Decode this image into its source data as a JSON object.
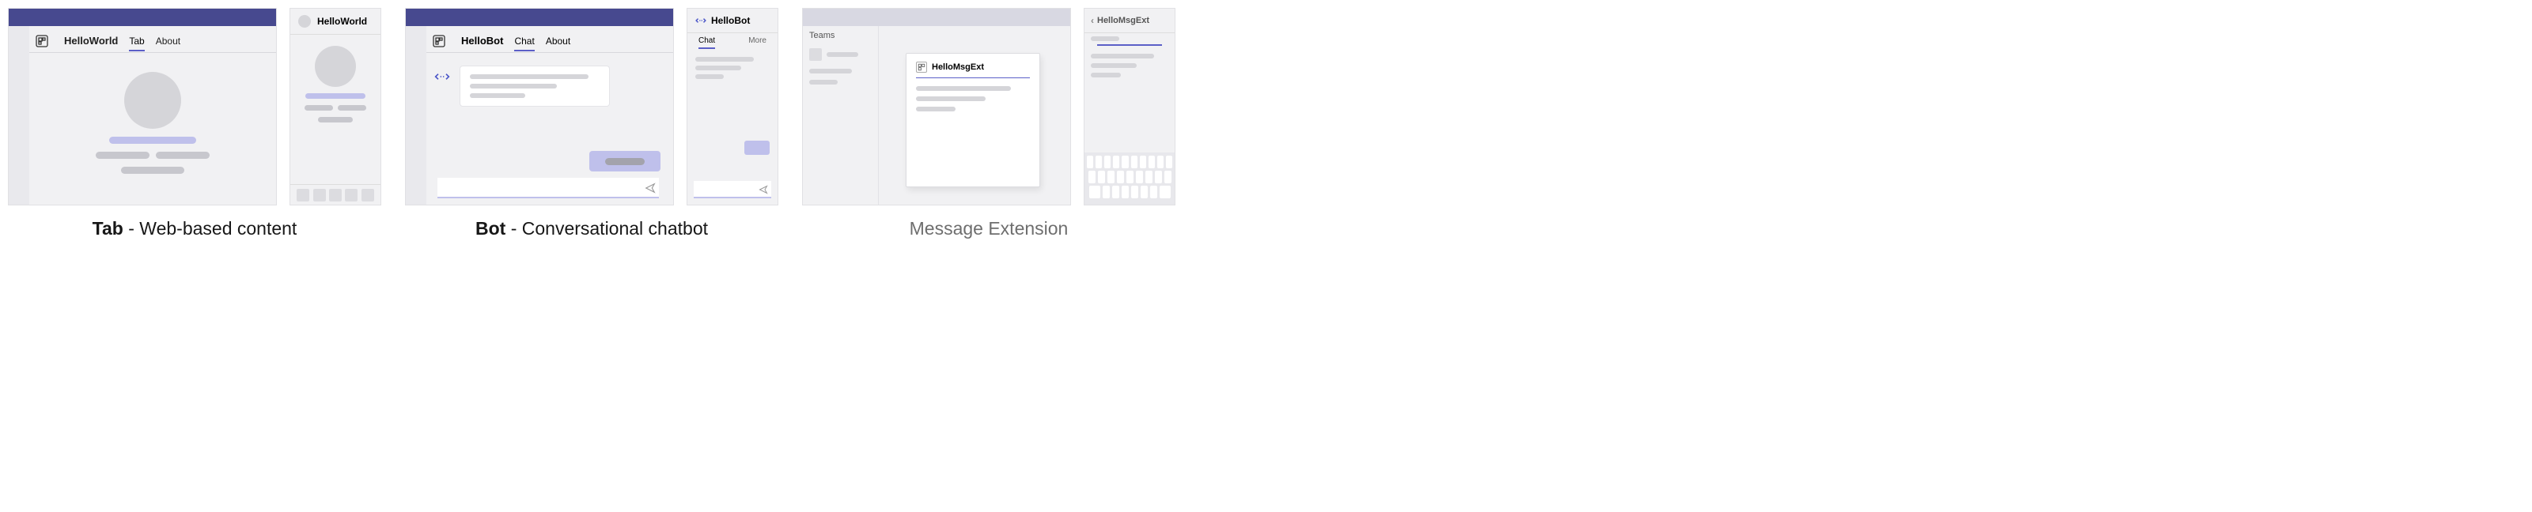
{
  "tab": {
    "desktop": {
      "app_title": "HelloWorld",
      "tabs": {
        "main": "Tab",
        "about": "About"
      }
    },
    "mobile": {
      "title": "HelloWorld"
    },
    "caption_bold": "Tab",
    "caption_rest": " - Web-based content"
  },
  "bot": {
    "desktop": {
      "app_title": "HelloBot",
      "tabs": {
        "chat": "Chat",
        "about": "About"
      }
    },
    "mobile": {
      "title": "HelloBot",
      "tabs": {
        "chat": "Chat",
        "more": "More"
      }
    },
    "caption_bold": "Bot",
    "caption_rest": " - Conversational chatbot"
  },
  "msgext": {
    "desktop": {
      "sidebar_label": "Teams",
      "card_title": "HelloMsgExt"
    },
    "mobile": {
      "title": "HelloMsgExt"
    },
    "caption": "Message Extension"
  }
}
